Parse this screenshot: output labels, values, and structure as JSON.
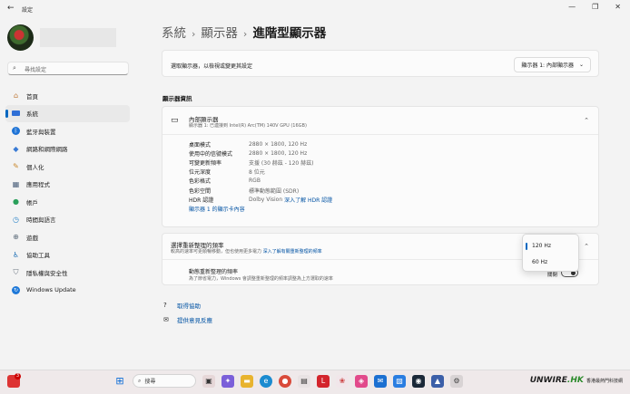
{
  "window": {
    "title": "設定",
    "back_icon": "back-arrow-icon",
    "controls": [
      "minimize",
      "maximize",
      "close"
    ]
  },
  "search": {
    "placeholder": "尋找設定"
  },
  "sidebar": {
    "items": [
      {
        "label": "首頁",
        "icon": "home-icon",
        "color": "#c07a3a"
      },
      {
        "label": "系統",
        "icon": "system-icon",
        "color": "#2f6fd6",
        "selected": true
      },
      {
        "label": "藍牙與裝置",
        "icon": "bluetooth-icon",
        "color": "#1e73d6"
      },
      {
        "label": "網路和網際網路",
        "icon": "network-icon",
        "color": "#3a7bd5"
      },
      {
        "label": "個人化",
        "icon": "brush-icon",
        "color": "#c9882d"
      },
      {
        "label": "應用程式",
        "icon": "apps-icon",
        "color": "#4a5f7a"
      },
      {
        "label": "帳戶",
        "icon": "account-icon",
        "color": "#2aa05b"
      },
      {
        "label": "時間與語言",
        "icon": "clock-globe-icon",
        "color": "#2f86c9"
      },
      {
        "label": "遊戲",
        "icon": "gamepad-icon",
        "color": "#5d6b7a"
      },
      {
        "label": "協助工具",
        "icon": "accessibility-icon",
        "color": "#1f6fb5"
      },
      {
        "label": "隱私權與安全性",
        "icon": "shield-icon",
        "color": "#6b7580"
      },
      {
        "label": "Windows Update",
        "icon": "update-icon",
        "color": "#1e78d8"
      }
    ]
  },
  "breadcrumb": {
    "part1": "系統",
    "part2": "顯示器",
    "current": "進階型顯示器",
    "separator": "›"
  },
  "select_display": {
    "label": "選取顯示器，以檢視或變更其設定",
    "value": "顯示器 1: 內部顯示器"
  },
  "display_info": {
    "section_title": "顯示器資訊",
    "name": "內部顯示器",
    "subtitle": "顯示器 1: 已連接到 Intel(R) Arc(TM) 140V GPU (16GB)",
    "rows": [
      {
        "k": "桌面模式",
        "v": "2880 × 1800, 120 Hz"
      },
      {
        "k": "使用中的信號模式",
        "v": "2880 × 1800, 120 Hz"
      },
      {
        "k": "可變更新頻率",
        "v": "支援 (30 赫茲 - 120 赫茲)"
      },
      {
        "k": "位元深度",
        "v": "8 位元"
      },
      {
        "k": "色彩格式",
        "v": "RGB"
      },
      {
        "k": "色彩空間",
        "v": "標準動態範圍 (SDR)"
      },
      {
        "k": "HDR 認證",
        "v": "Dolby Vision",
        "link": "深入了解 HDR 認證"
      }
    ],
    "adapter_link": "顯示器 1 的顯示卡內容"
  },
  "refresh": {
    "title": "選擇重新整理的頻率",
    "desc": "較高的速率可更順暢移動，但也使用更多電力",
    "desc_link": "深入了解有關重新整理的頻率",
    "dynamic_title": "動態重新整理的頻率",
    "dynamic_desc": "為了節省電力，Windows 會調整重新整理的頻率調整為上方選取的速率",
    "toggle_label": "關閉",
    "options": [
      "120 Hz",
      "60 Hz"
    ],
    "selected": "120 Hz"
  },
  "help": {
    "get_help": "取得協助",
    "feedback": "提供意見反應"
  },
  "taskbar": {
    "search": "搜尋",
    "badge": "3",
    "brand": "UNWIRE",
    "brand_tld": ".HK",
    "brand_sub": "香港最熱門科技網"
  }
}
